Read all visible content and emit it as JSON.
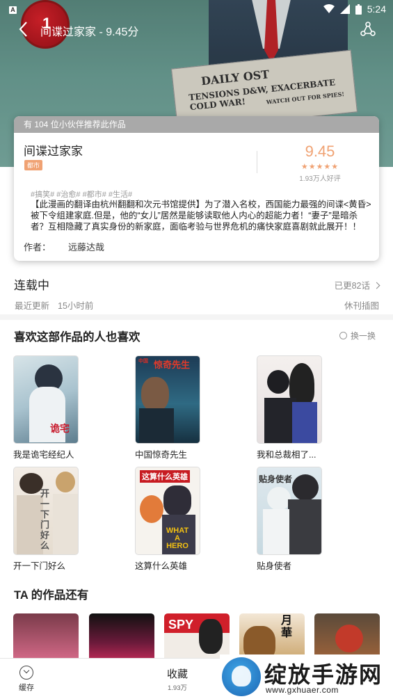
{
  "status_bar": {
    "time": "5:24",
    "app_icon_letter": "A"
  },
  "rank_badge": "1",
  "header": {
    "title": "间谍过家家 - 9.45分"
  },
  "hero_art": {
    "paper_line1": "DAILY OST",
    "paper_line2": "TENSIONS D&W, EXACERBATE COLD WAR!",
    "paper_line3": "WATCH OUT FOR SPIES!"
  },
  "card": {
    "recommend_text": "有 104 位小伙伴推荐此作品",
    "name": "间谍过家家",
    "genre_tag": "都市",
    "score": "9.45",
    "stars": "★★★★★",
    "votes": "1.93万人好评",
    "tags": "#搞笑# #治愈# #都市# #生活#",
    "description": "【此漫画的翻译由杭州翻翻和次元书馆提供】为了潜入名校，西国能力最强的间谍<黄昏>被下令组建家庭.但是，他的“女儿”居然是能够读取他人内心的超能力者！“妻子”是暗杀者？互相隐藏了真实身份的新家庭，面临考验与世界危机的痛快家庭喜剧就此展开！！",
    "author_label": "作者：",
    "author": "远藤达哉"
  },
  "status": {
    "serial": "连载中",
    "updated_count": "已更82话",
    "recent_label": "最近更新",
    "recent_time": "15小时前",
    "hiatus": "休刊插图"
  },
  "recommend_section": {
    "title": "喜欢这部作品的人也喜欢",
    "refresh_label": "换一换",
    "items": [
      {
        "title": "我是诡宅经纪人",
        "cover_text": "诡宅"
      },
      {
        "title": "中国惊奇先生",
        "cover_text": "惊奇先生",
        "cover_small": "中国"
      },
      {
        "title": "我和总裁相了...",
        "cover_text": ""
      },
      {
        "title": "开一下门好么",
        "cover_text": "开一下门好么"
      },
      {
        "title": "这算什么英雄",
        "cover_text": "这算什么英雄",
        "cover_en1": "WHAT",
        "cover_en2": "A",
        "cover_en3": "HERO"
      },
      {
        "title": "贴身使者",
        "cover_text": "贴身使者"
      }
    ]
  },
  "author_section": {
    "title": "TA 的作品还有",
    "covers": [
      "",
      "",
      "SPY",
      "月華",
      ""
    ]
  },
  "bottom_bar": {
    "cache_label": "缓存",
    "fav_label": "收藏",
    "fav_count": "1.93万"
  },
  "watermark": {
    "big": "绽放手游网",
    "small": "www.gxhuaer.com"
  }
}
